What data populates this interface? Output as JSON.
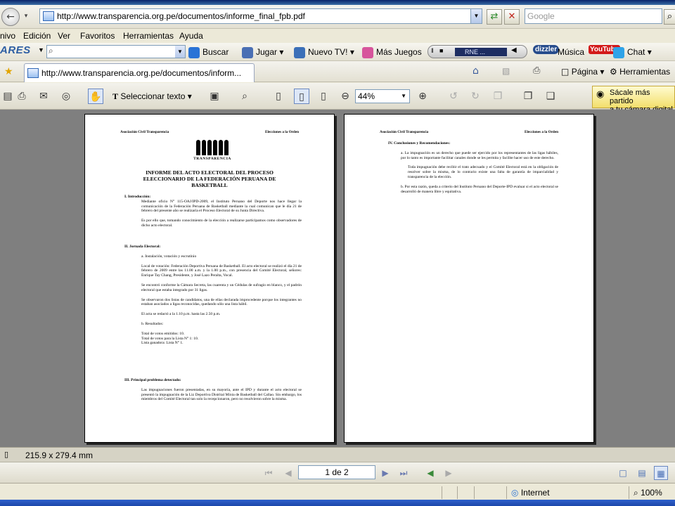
{
  "browser": {
    "address_url": "http://www.transparencia.org.pe/documentos/informe_final_fpb.pdf",
    "search_placeholder": "Google",
    "menu": [
      "nivo",
      "Edición",
      "Ver",
      "Favoritos",
      "Herramientas",
      "Ayuda"
    ],
    "toolbar": {
      "brand": "ARES",
      "buscar": "Buscar",
      "jugar": "Jugar",
      "nuevo_tv": "Nuevo TV!",
      "mas_juegos": "Más Juegos",
      "radio_station": "RNE ...",
      "musica": "Música",
      "chat": "Chat",
      "dizzler_logo": "dizzler",
      "youtube_logo": "YouTube"
    },
    "tab_title": "http://www.transparencia.org.pe/documentos/inform...",
    "tab_tools": {
      "pagina": "Página",
      "herramientas": "Herramientas"
    }
  },
  "pdf": {
    "select_text_label": "Seleccionar texto",
    "zoom": "44%",
    "promo_line1": "Sácale más partido",
    "promo_line2": "a tu cámara digital",
    "page_size": "215.9 x 279.4 mm",
    "page_indicator": "1 de 2"
  },
  "status": {
    "zone": "Internet",
    "zoom": "100%"
  },
  "document": {
    "page1": {
      "header_left": "Asociación Civil Transparencia",
      "header_right": "Elecciones a la Orden",
      "logo_text": "TRANSPARENCIA",
      "title": "INFORME DEL ACTO ELECTORAL DEL PROCESO ELECCIONARIO DE LA FEDERACIÓN PERUANA DE BASKETBALL",
      "s1_head": "I.      Introducción:",
      "s1_p1": "Mediante oficio N° 115-OAJ/IPD-2009, el Instituto Peruano del Deporte nos hace llegar la comunicación de la Federación Peruana de Basketball mediante la cual comunican que le día 21 de febrero del presente año se realizaría el Proceso Electoral de su Junta Directiva.",
      "s1_p2": "Es por ello que, tomando conocimiento de la elección a realizarse participamos como observadores de dicho acto electoral.",
      "s2_head": "II.     Jornada Electoral:",
      "s2_sub_a": "a. Instalación, votación y escrutinio",
      "s2_p1": "Local de votación: Federación Deportiva Peruana de Basketball. El acto electoral se realizó el día 21 de febrero de 2009 entre las 11.00 a.m. y la 1.00 p.m., con presencia del Comité Electoral, señores: Enrique Tay Chang, Presidente, y José Lazo Peralta, Vocal.",
      "s2_p2": "Se encontró conforme la Cámara Secreta, las cuarenta y un Cédulas de sufragio en blanco, y el padrón electoral que estaba integrado por 31 ligas.",
      "s2_p3": "Se observaron dos listas de candidatos, una de ellas declarada improcedente porque los integrantes no estaban asociados a ligas reconocidas, quedando sólo una lista hábil.",
      "s2_p4": "El acta se redactó a la 1.10 p.m. hasta las 2.50 p.m.",
      "s2_sub_b": "b. Resultados:",
      "s2_r1": "Total de votos emitidos: 10.",
      "s2_r2": "Total de votos para la Lista N° 1: 10.",
      "s2_r3": "Lista ganadora: Lista N° 1.",
      "s3_head": "III.    Principal problema detectado:",
      "s3_p1": "Las impugnaciones fueron presentadas, en su mayoría, ante el IPD y durante el acto electoral se presentó la impugnación de la Liz Deportiva Distrital Mixta de Basketball del Callao. Sin embargo, los miembros del Comité Electoral tan solo la recepcionaron, pero no resolvieron sobre la misma."
    },
    "page2": {
      "header_left": "Asociación Civil Transparencia",
      "header_right": "Elecciones a la Orden",
      "s4_head": "IV.     Conclusiones y Recomendaciones:",
      "s4_a": "a.   La impugnación es un derecho que puede ser ejercido por los representantes de las ligas hábiles, por lo tanto es importante facilitar canales donde se les permita y facilite hacer uso de este derecho.",
      "s4_a2": "Toda impugnación debe recibir el trato adecuado y el Comité Electoral está en la obligación de resolver sobre la misma, de lo contrario existe una falta de garantía de imparcialidad y transparencia de la elección.",
      "s4_b": "b.   Por esta razón, queda a criterio del Instituto Peruano del Deporte-IPD evaluar si el acto electoral se desarrolló de manera libre y equitativa."
    }
  },
  "colors": {
    "viewer_bg": "#7f7f7f",
    "chrome_bg": "#ece9d8",
    "link_blue": "#2d5ea3"
  }
}
